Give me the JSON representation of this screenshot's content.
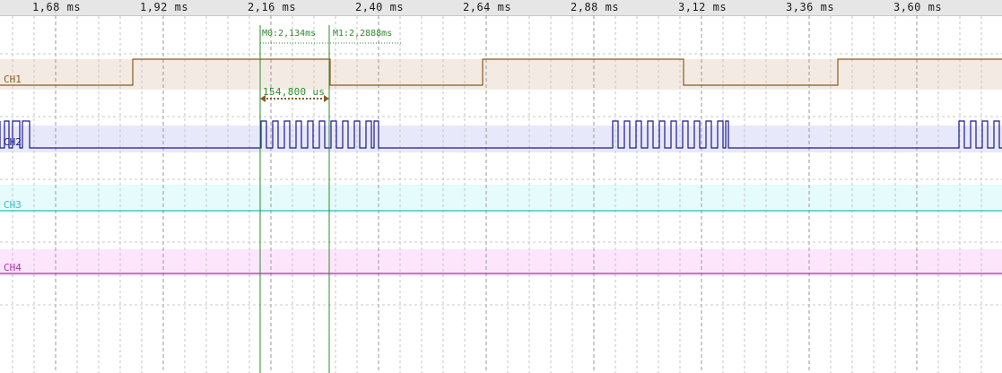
{
  "ruler": {
    "ticks": [
      "1,68 ms",
      "1,92 ms",
      "2,16 ms",
      "2,40 ms",
      "2,64 ms",
      "2,88 ms",
      "3,12 ms",
      "3,36 ms",
      "3,60 ms"
    ]
  },
  "channels": [
    {
      "label": "CH1",
      "color": "#8b5a1e",
      "band_color": "#f3ebe3"
    },
    {
      "label": "CH2",
      "color": "#1a1a8c",
      "band_color": "#e8e8fb"
    },
    {
      "label": "CH3",
      "color": "#2ec4c4",
      "band_color": "#e6fbfb"
    },
    {
      "label": "CH4",
      "color": "#b02fb0",
      "band_color": "#fde6fb"
    }
  ],
  "markers": {
    "m0": "M0:2,134ms",
    "m1": "M1:2,2888ms",
    "delta": "154,800 us",
    "color": "#2e8b2e"
  }
}
